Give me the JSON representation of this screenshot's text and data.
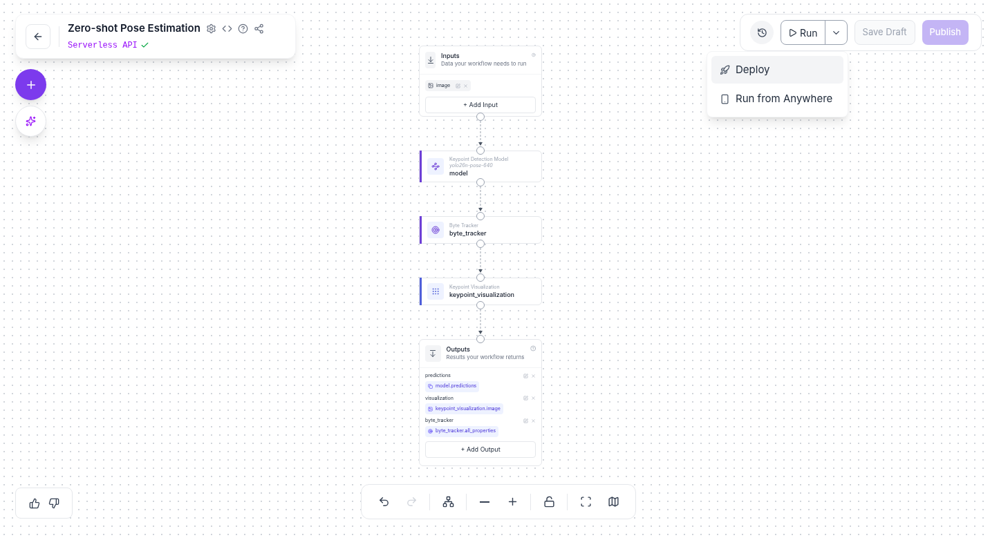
{
  "header": {
    "title": "Zero-shot Pose Estimation",
    "subtitle": "Serverless API",
    "deployed": true
  },
  "toolbar": {
    "run": "Run",
    "save_draft": {
      "label": "Save Draft",
      "disabled": true
    },
    "publish": {
      "label": "Publish",
      "disabled": true
    }
  },
  "run_menu": [
    {
      "kind": "deploy",
      "label": "Deploy",
      "selected": true
    },
    {
      "kind": "anywhere",
      "label": "Run from Anywhere",
      "selected": false
    }
  ],
  "nodes": [
    {
      "kind": "inputs",
      "title": "Inputs",
      "description": "Data your workflow needs to run",
      "items": [
        {
          "label": "image"
        }
      ],
      "add_label": "+ Add Input"
    },
    {
      "kind": "block",
      "category": "Keypoint Detection Model",
      "model_id": "yolo26n-pose-640",
      "name": "model",
      "color": "#6d3fd6"
    },
    {
      "kind": "block",
      "category": "Byte Tracker",
      "name": "byte_tracker",
      "color": "#6d3fd6"
    },
    {
      "kind": "block",
      "category": "Keypoint Visualization",
      "name": "keypoint_visualization",
      "color": "#4f5fd9"
    },
    {
      "kind": "outputs",
      "title": "Outputs",
      "description": "Results your workflow returns",
      "outputs": [
        {
          "name": "predictions",
          "value": "model.predictions"
        },
        {
          "name": "visualization",
          "value": "keypoint_visualization.image"
        },
        {
          "name": "byte_tracker",
          "value": "byte_tracker.all_properties"
        }
      ],
      "add_label": "+ Add Output"
    }
  ],
  "canvas_controls": [
    {
      "kind": "undo",
      "disabled": false
    },
    {
      "kind": "redo",
      "disabled": true
    },
    {
      "kind": "layout",
      "disabled": false
    },
    {
      "kind": "zoom_out",
      "disabled": false
    },
    {
      "kind": "zoom_in",
      "disabled": false
    },
    {
      "kind": "lock",
      "disabled": false
    },
    {
      "kind": "fit",
      "disabled": false
    },
    {
      "kind": "minimap",
      "disabled": false
    }
  ]
}
